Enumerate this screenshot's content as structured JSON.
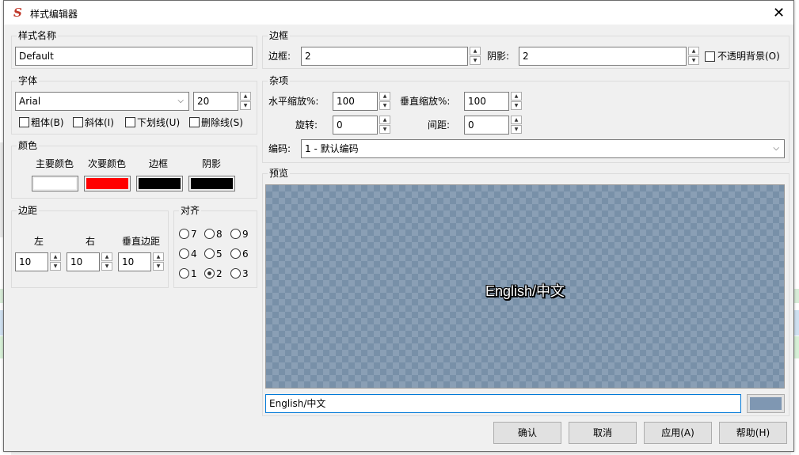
{
  "window": {
    "title": "样式编辑器",
    "close": "✕",
    "icon_glyph": "S"
  },
  "style_name": {
    "label": "样式名称",
    "value": "Default"
  },
  "font": {
    "label": "字体",
    "family": "Arial",
    "size": "20",
    "bold": "粗体(B)",
    "italic": "斜体(I)",
    "underline": "下划线(U)",
    "strikeout": "删除线(S)"
  },
  "colors": {
    "label": "颜色",
    "primary": {
      "label": "主要颜色",
      "color": "#ffffff"
    },
    "secondary": {
      "label": "次要颜色",
      "color": "#ff0000"
    },
    "outline": {
      "label": "边框",
      "color": "#000000"
    },
    "shadow": {
      "label": "阴影",
      "color": "#000000"
    }
  },
  "margins": {
    "label": "边距",
    "left_label": "左",
    "left": "10",
    "right_label": "右",
    "right": "10",
    "vertical_label": "垂直边距",
    "vertical": "10"
  },
  "alignment": {
    "label": "对齐",
    "options": [
      "7",
      "8",
      "9",
      "4",
      "5",
      "6",
      "1",
      "2",
      "3"
    ],
    "selected": "2"
  },
  "border": {
    "label": "边框",
    "outline_label": "边框:",
    "outline": "2",
    "shadow_label": "阴影:",
    "shadow": "2",
    "opaque": "不透明背景(O)"
  },
  "misc": {
    "label": "杂项",
    "scale_x_label": "水平缩放%:",
    "scale_x": "100",
    "scale_y_label": "垂直缩放%:",
    "scale_y": "100",
    "angle_label": "旋转:",
    "angle": "0",
    "spacing_label": "间距:",
    "spacing": "0",
    "encoding_label": "编码:",
    "encoding": "1 - 默认编码"
  },
  "preview": {
    "label": "预览",
    "text": "English/中文",
    "input": "English/中文",
    "bg_color": "#7f97b2"
  },
  "buttons": {
    "ok": "确认",
    "cancel": "取消",
    "apply": "应用(A)",
    "help": "帮助(H)"
  }
}
